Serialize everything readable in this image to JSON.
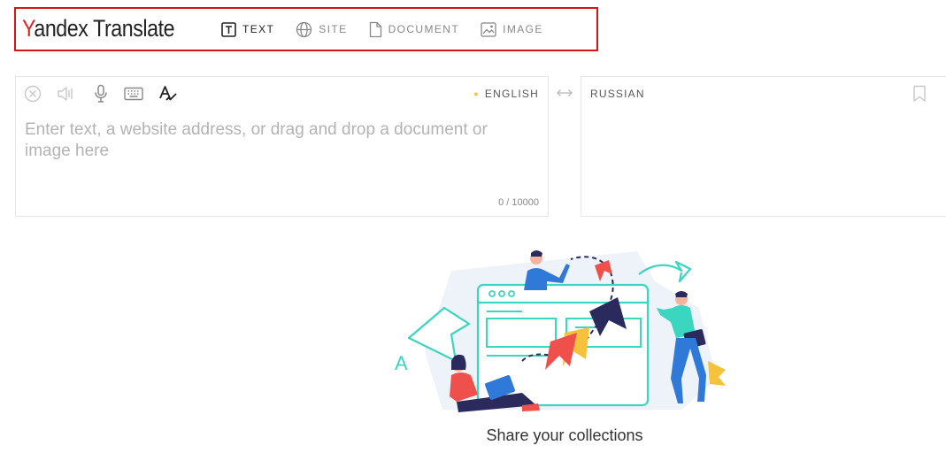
{
  "header": {
    "logo_initial": "Y",
    "logo_rest": "andex Translate",
    "tabs": [
      {
        "label": "TEXT",
        "icon": "text-icon",
        "active": true
      },
      {
        "label": "SITE",
        "icon": "globe-icon",
        "active": false
      },
      {
        "label": "DOCUMENT",
        "icon": "document-icon",
        "active": false
      },
      {
        "label": "IMAGE",
        "icon": "image-icon",
        "active": false
      }
    ]
  },
  "source": {
    "language": "ENGLISH",
    "placeholder": "Enter text, a website address, or drag and drop a document or image here",
    "value": "",
    "counter": "0 / 10000",
    "tools": [
      "clear-icon",
      "speaker-icon",
      "microphone-icon",
      "keyboard-icon",
      "spellcheck-icon"
    ]
  },
  "target": {
    "language": "RUSSIAN"
  },
  "promo": {
    "caption": "Share your collections"
  },
  "colors": {
    "brand_red": "#e61e1e",
    "highlight_border": "#d4151b",
    "star": "#f7c23b",
    "accent_teal": "#3ad6c0",
    "accent_navy": "#2a2a5c",
    "accent_blue": "#2f79d8",
    "accent_red": "#f0504c",
    "accent_yellow": "#f7c23b"
  }
}
